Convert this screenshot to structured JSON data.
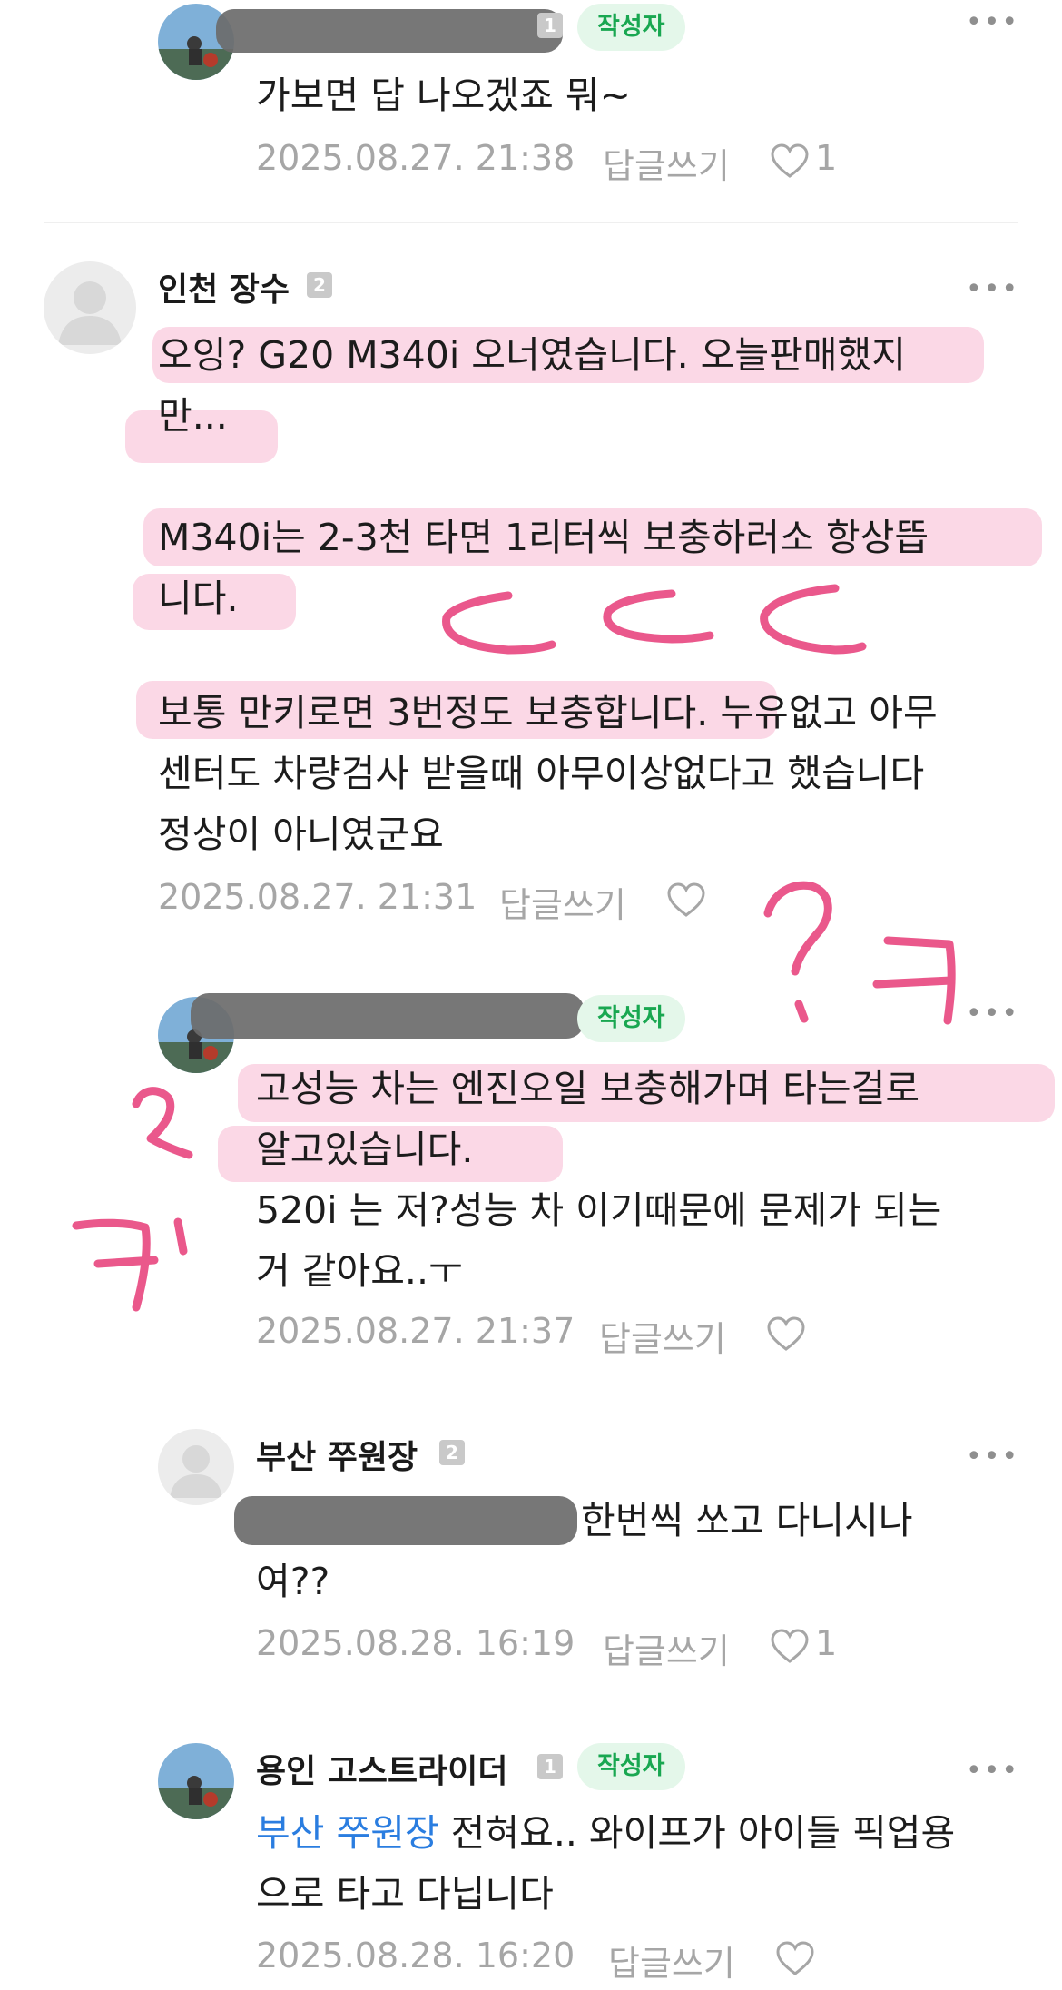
{
  "labels": {
    "author_badge": "작성자",
    "reply_action": "답글쓰기",
    "more_menu": "•••"
  },
  "comments": [
    {
      "author": "",
      "level": "1",
      "is_author": true,
      "text": [
        "가보면 답 나오겠죠 뭐~"
      ],
      "timestamp": "2025.08.27. 21:38",
      "likes": "1"
    },
    {
      "author": "인천 장수",
      "level": "2",
      "is_author": false,
      "text": [
        "오잉? G20 M340i 오너였습니다. 오늘판매했지",
        "만...",
        "",
        "M340i는 2-3천 타면 1리터씩 보충하러소 항상뜹",
        "니다.",
        "",
        "보통 만키로면 3번정도 보충합니다. 누유없고 아무",
        "센터도 차량검사 받을때 아무이상없다고 했습니다",
        "정상이 아니였군요"
      ],
      "timestamp": "2025.08.27. 21:31",
      "likes": ""
    },
    {
      "author": "",
      "level": "",
      "is_author": true,
      "text": [
        "고성능 차는 엔진오일 보충해가며 타는걸로",
        "알고있습니다.",
        "520i 는 저?성능 차 이기때문에 문제가 되는",
        "거 같아요..ㅜ"
      ],
      "timestamp": "2025.08.27. 21:37",
      "likes": ""
    },
    {
      "author": "부산 쭈원장",
      "level": "2",
      "is_author": false,
      "text_suffix": "한번씩 쏘고 다니시나",
      "text": [
        "여??"
      ],
      "timestamp": "2025.08.28. 16:19",
      "likes": "1"
    },
    {
      "author": "용인 고스트라이더",
      "level": "1",
      "is_author": true,
      "mention": "부산 쭈원장",
      "text_first": " 전혀요.. 와이프가 아이들 픽업용",
      "text": [
        "으로 타고 다닙니다"
      ],
      "timestamp": "2025.08.28. 16:20",
      "likes": ""
    }
  ],
  "annotations": {
    "marks": [
      "ㄷ",
      "ㄷ",
      "ㄷ",
      "?ㅋ",
      "?ㅋ"
    ],
    "color": "#e8467f"
  },
  "colors": {
    "badge_text": "#19a751",
    "badge_bg": "#e4f7ea",
    "mention": "#2a7de0",
    "meta": "#a6a6a6"
  }
}
